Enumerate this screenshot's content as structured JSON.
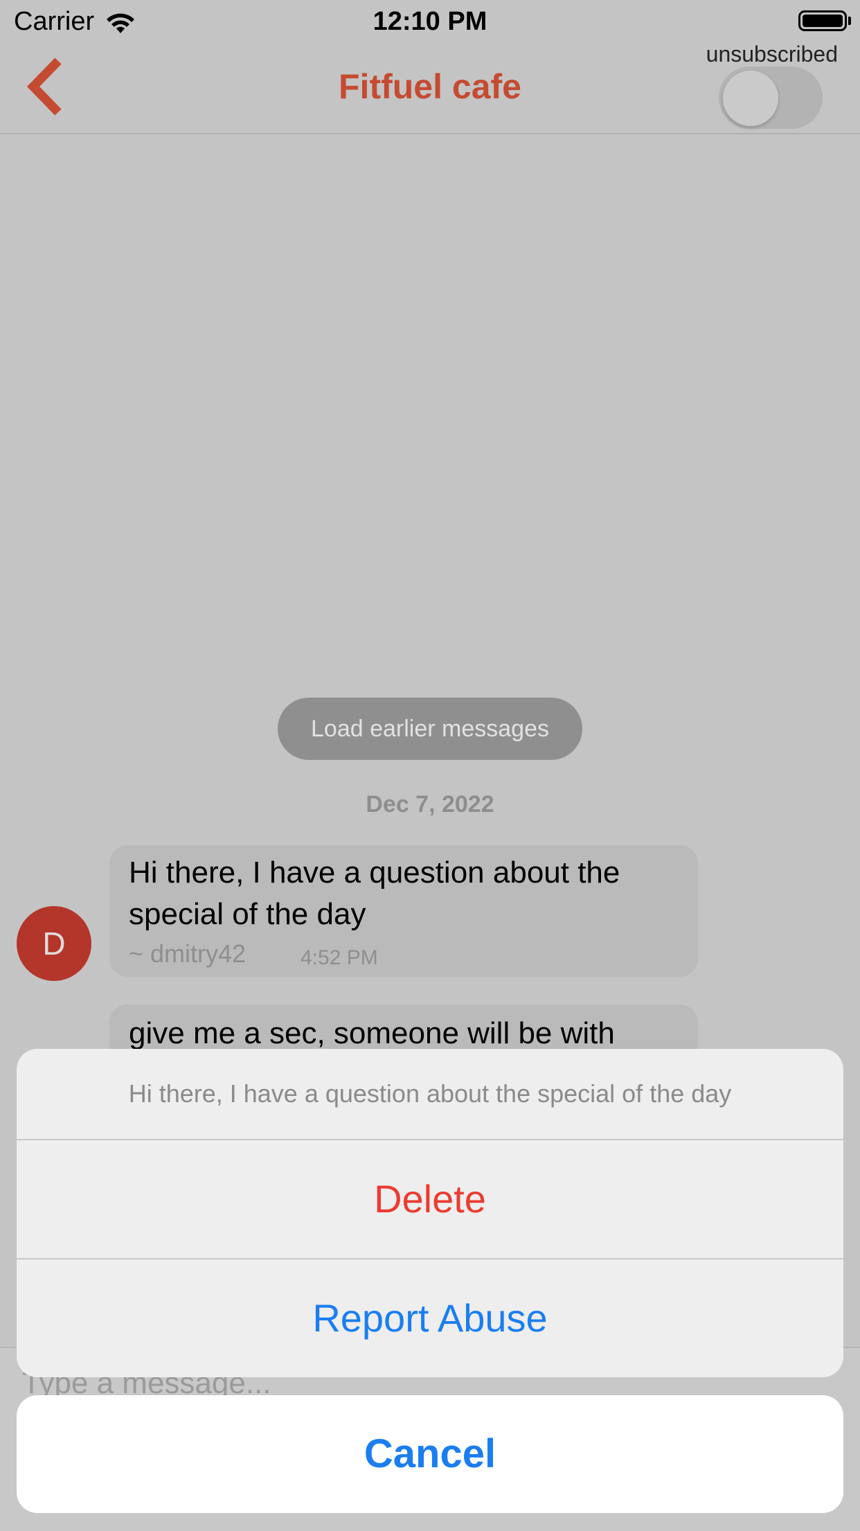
{
  "status_bar": {
    "carrier": "Carrier",
    "time": "12:10 PM",
    "icons": [
      "wifi-icon",
      "battery-icon"
    ]
  },
  "nav": {
    "back_icon": "chevron-left-icon",
    "title": "Fitfuel cafe",
    "subscription_label": "unsubscribed",
    "subscription_toggle_on": false,
    "accent_color": "#c44b31"
  },
  "chat": {
    "load_earlier": "Load earlier messages",
    "date": "Dec 7, 2022",
    "messages": [
      {
        "avatar_initial": "D",
        "text": "Hi there, I have a question about the special of the day",
        "user": "~ dmitry42",
        "time": "4:52 PM"
      },
      {
        "text": "give me a sec, someone will be with"
      }
    ],
    "input_placeholder": "Type a message..."
  },
  "action_sheet": {
    "message": "Hi there, I have a question about the special of the day",
    "delete_label": "Delete",
    "report_label": "Report Abuse",
    "cancel_label": "Cancel",
    "destructive_color": "#eb3b30",
    "action_color": "#1a7ef0"
  }
}
